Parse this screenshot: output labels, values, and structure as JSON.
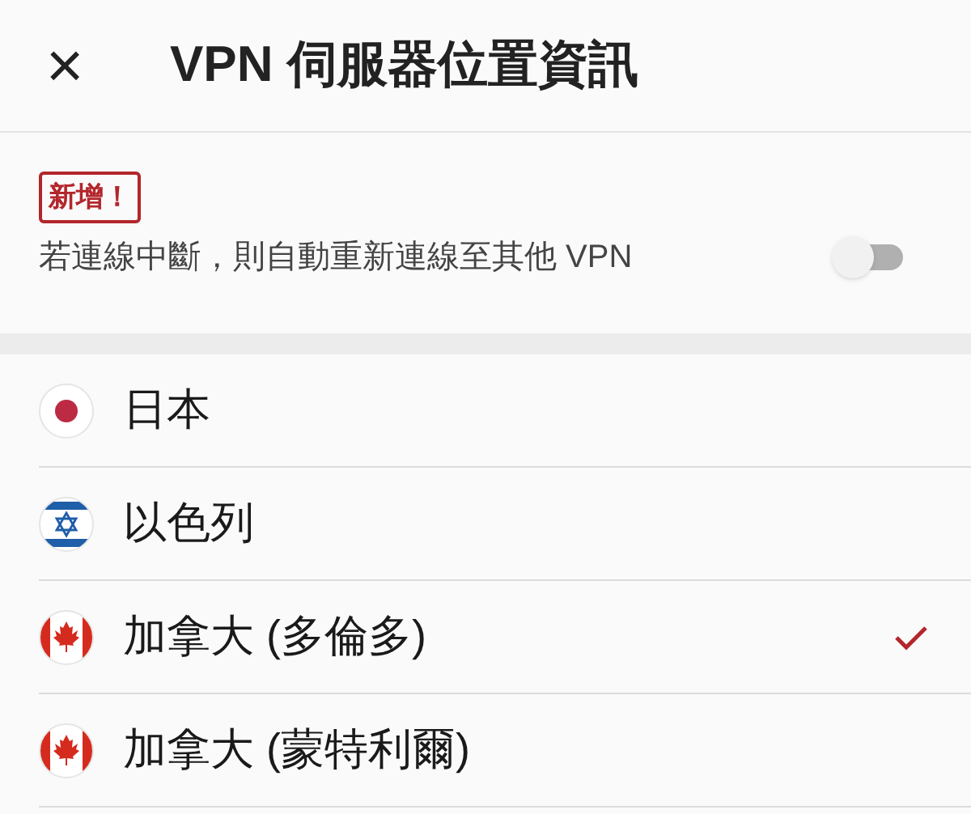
{
  "header": {
    "close": "×",
    "title": "VPN 伺服器位置資訊"
  },
  "reconnect": {
    "badge": "新增！",
    "label": "若連線中斷，則自動重新連線至其他 VPN",
    "on": false
  },
  "locations": [
    {
      "name": "日本",
      "kind": "japan",
      "selected": false
    },
    {
      "name": "以色列",
      "kind": "israel",
      "selected": false
    },
    {
      "name": "加拿大 (多倫多)",
      "kind": "canada",
      "selected": true
    },
    {
      "name": "加拿大 (蒙特利爾)",
      "kind": "canada",
      "selected": false
    }
  ]
}
